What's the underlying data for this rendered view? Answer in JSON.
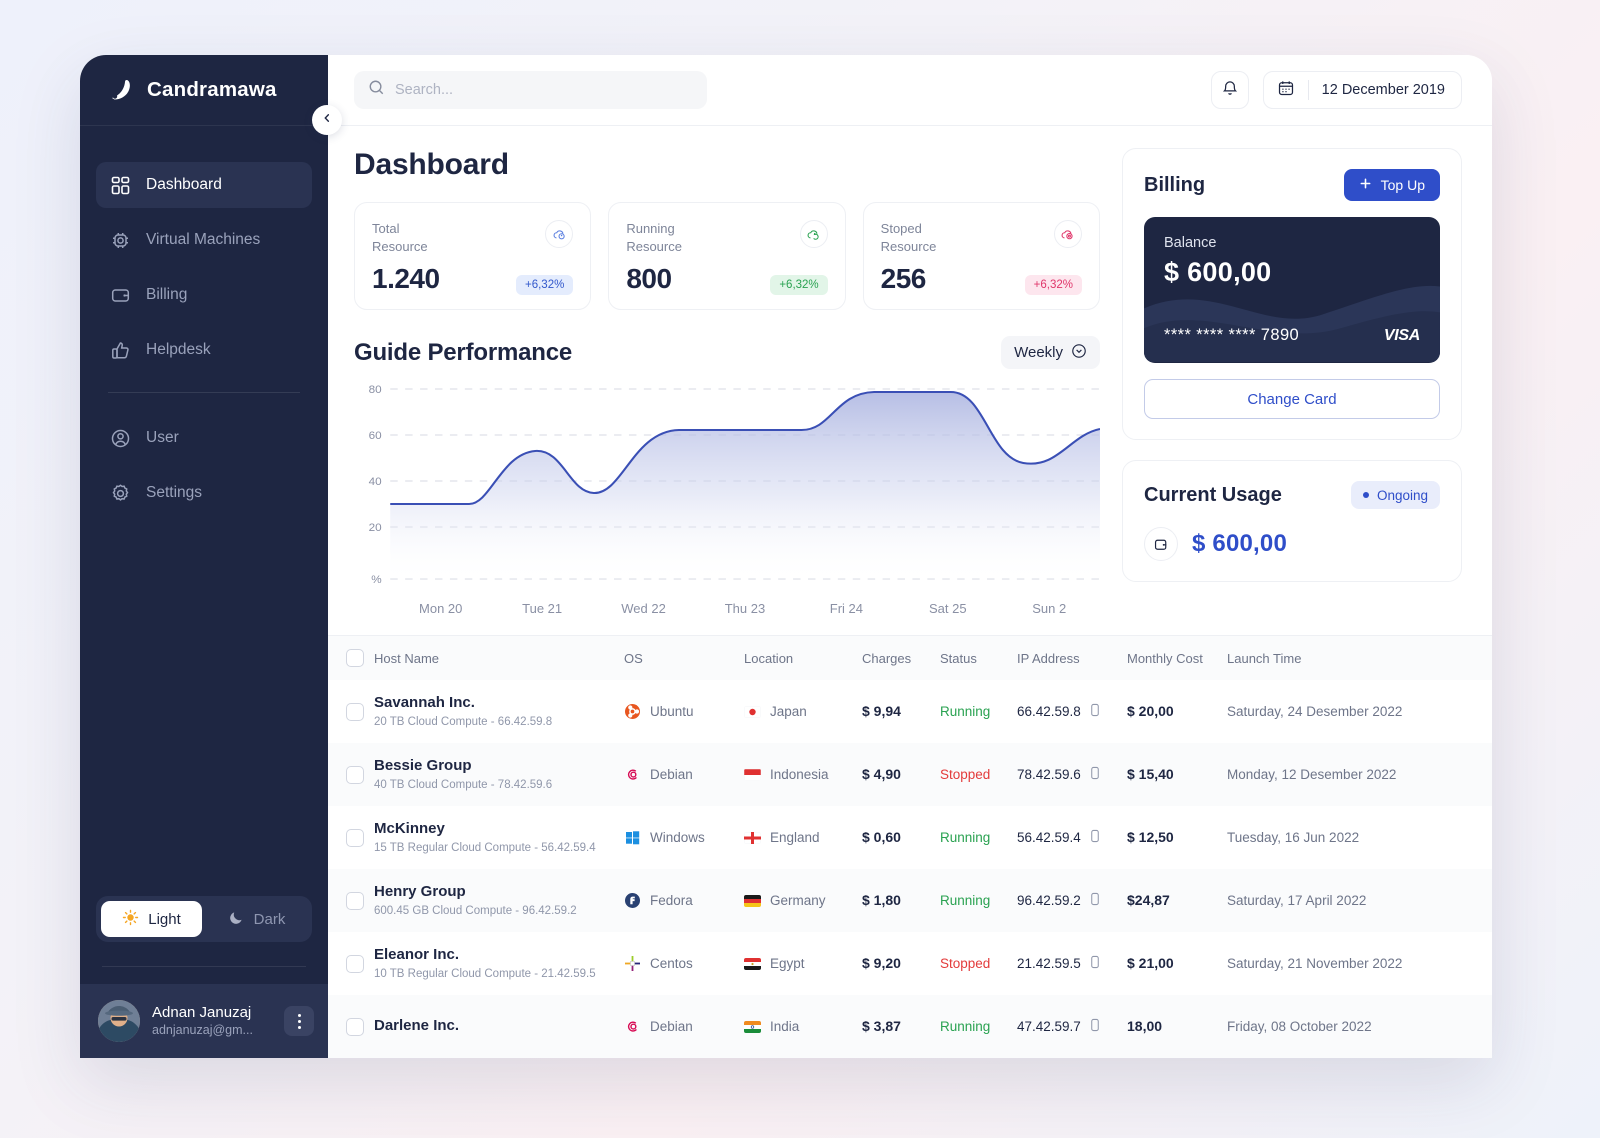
{
  "brand": {
    "name": "Candramawa",
    "logo_icon": "swoosh-logo-icon"
  },
  "sidebar": {
    "items": [
      {
        "label": "Dashboard",
        "icon": "grid-icon",
        "active": true
      },
      {
        "label": "Virtual Machines",
        "icon": "cpu-chip-icon",
        "active": false
      },
      {
        "label": "Billing",
        "icon": "wallet-icon",
        "active": false
      },
      {
        "label": "Helpdesk",
        "icon": "thumbs-up-icon",
        "active": false
      }
    ],
    "secondary_items": [
      {
        "label": "User",
        "icon": "user-circle-icon"
      },
      {
        "label": "Settings",
        "icon": "gear-icon"
      }
    ],
    "theme": {
      "light_label": "Light",
      "dark_label": "Dark",
      "selected": "Light"
    },
    "user": {
      "name": "Adnan Januzaj",
      "email": "adnjanuzaj@gm...",
      "menu_icon": "kebab-menu-icon"
    },
    "collapse_icon": "chevron-left-icon"
  },
  "topbar": {
    "search": {
      "placeholder": "Search...",
      "value": "",
      "icon": "search-icon"
    },
    "notification_icon": "bell-icon",
    "calendar_icon": "calendar-icon",
    "date": "12 December 2019"
  },
  "page": {
    "title": "Dashboard"
  },
  "stats": [
    {
      "label": "Total\nResource",
      "label_line1": "Total",
      "label_line2": "Resource",
      "value": "1.240",
      "delta": "+6,32%",
      "tone": "blue",
      "icon": "cloud-total-icon"
    },
    {
      "label_line1": "Running",
      "label_line2": "Resource",
      "value": "800",
      "delta": "+6,32%",
      "tone": "green",
      "icon": "cloud-running-icon"
    },
    {
      "label_line1": "Stoped",
      "label_line2": "Resource",
      "value": "256",
      "delta": "+6,32%",
      "tone": "red",
      "icon": "cloud-stopped-icon"
    }
  ],
  "chart_section": {
    "title": "Guide Performance",
    "period": "Weekly",
    "period_icon": "chevron-down-circle-icon"
  },
  "chart_data": {
    "type": "area",
    "title": "Guide Performance",
    "xlabel": "",
    "ylabel": "%",
    "categories": [
      "Mon 20",
      "Tue 21",
      "Wed 22",
      "Thu 23",
      "Fri 24",
      "Sat 25",
      "Sun 2"
    ],
    "x": [
      "Mon 20",
      "Tue 21",
      "Wed 22",
      "Thu 23",
      "Fri 24",
      "Sat 25",
      "Sun 2"
    ],
    "values": [
      25,
      50,
      43,
      62,
      62,
      78,
      53
    ],
    "series": [
      {
        "name": "Performance",
        "values": [
          25,
          50,
          43,
          62,
          62,
          78,
          53
        ]
      }
    ],
    "ytick_labels": [
      "80",
      "60",
      "40",
      "20",
      "%"
    ],
    "yticks": [
      80,
      60,
      40,
      20,
      0
    ],
    "ylim": [
      0,
      88
    ],
    "grid": true,
    "legend": "none",
    "line_color": "#3a4fb5",
    "fill_color": "#c7cdea"
  },
  "billing": {
    "title": "Billing",
    "topup_label": "Top Up",
    "topup_icon": "plus-icon",
    "card": {
      "balance_label": "Balance",
      "balance_amount": "$ 600,00",
      "number": "**** **** **** 7890",
      "brand": "VISA"
    },
    "change_card_label": "Change Card"
  },
  "usage": {
    "title": "Current Usage",
    "status": "Ongoing",
    "amount": "$ 600,00",
    "icon": "wallet-icon"
  },
  "table": {
    "columns": [
      "Host Name",
      "OS",
      "Location",
      "Charges",
      "Status",
      "IP Address",
      "Monthly Cost",
      "Launch Time"
    ],
    "rows": [
      {
        "host": "Savannah Inc.",
        "sub": "20 TB Cloud Compute - 66.42.59.8",
        "os": "Ubuntu",
        "os_icon": "ubuntu-icon",
        "location": "Japan",
        "flag": "jp",
        "charges": "$ 9,94",
        "status": "Running",
        "ip": "66.42.59.8",
        "copy_icon": "copy-icon",
        "cost": "$ 20,00",
        "launch": "Saturday, 24 Desember 2022"
      },
      {
        "host": "Bessie Group",
        "sub": "40 TB Cloud Compute - 78.42.59.6",
        "os": "Debian",
        "os_icon": "debian-icon",
        "location": "Indonesia",
        "flag": "id",
        "charges": "$ 4,90",
        "status": "Stopped",
        "ip": "78.42.59.6",
        "copy_icon": "copy-icon",
        "cost": "$ 15,40",
        "launch": "Monday, 12 Desember 2022"
      },
      {
        "host": "McKinney",
        "sub": "15 TB Regular Cloud Compute - 56.42.59.4",
        "os": "Windows",
        "os_icon": "windows-icon",
        "location": "England",
        "flag": "en",
        "charges": "$ 0,60",
        "status": "Running",
        "ip": "56.42.59.4",
        "copy_icon": "copy-icon",
        "cost": "$ 12,50",
        "launch": "Tuesday, 16 Jun 2022"
      },
      {
        "host": "Henry Group",
        "sub": "600.45 GB Cloud Compute - 96.42.59.2",
        "os": "Fedora",
        "os_icon": "fedora-icon",
        "location": "Germany",
        "flag": "de",
        "charges": "$ 1,80",
        "status": "Running",
        "ip": "96.42.59.2",
        "copy_icon": "copy-icon",
        "cost": "$24,87",
        "launch": "Saturday, 17 April 2022"
      },
      {
        "host": "Eleanor Inc.",
        "sub": "10 TB Regular Cloud Compute - 21.42.59.5",
        "os": "Centos",
        "os_icon": "centos-icon",
        "location": "Egypt",
        "flag": "eg",
        "charges": "$ 9,20",
        "status": "Stopped",
        "ip": "21.42.59.5",
        "copy_icon": "copy-icon",
        "cost": "$ 21,00",
        "launch": "Saturday, 21 November 2022"
      },
      {
        "host": "Darlene Inc.",
        "sub": "",
        "os": "Debian",
        "os_icon": "debian-icon",
        "location": "India",
        "flag": "in",
        "charges": "$ 3,87",
        "status": "Running",
        "ip": "47.42.59.7",
        "copy_icon": "copy-icon",
        "cost": "18,00",
        "launch": "Friday, 08 October 2022"
      }
    ]
  },
  "colors": {
    "accent": "#2f4ec9",
    "sidebar": "#1e2642",
    "running": "#2aa251",
    "stopped": "#e33b3b"
  }
}
